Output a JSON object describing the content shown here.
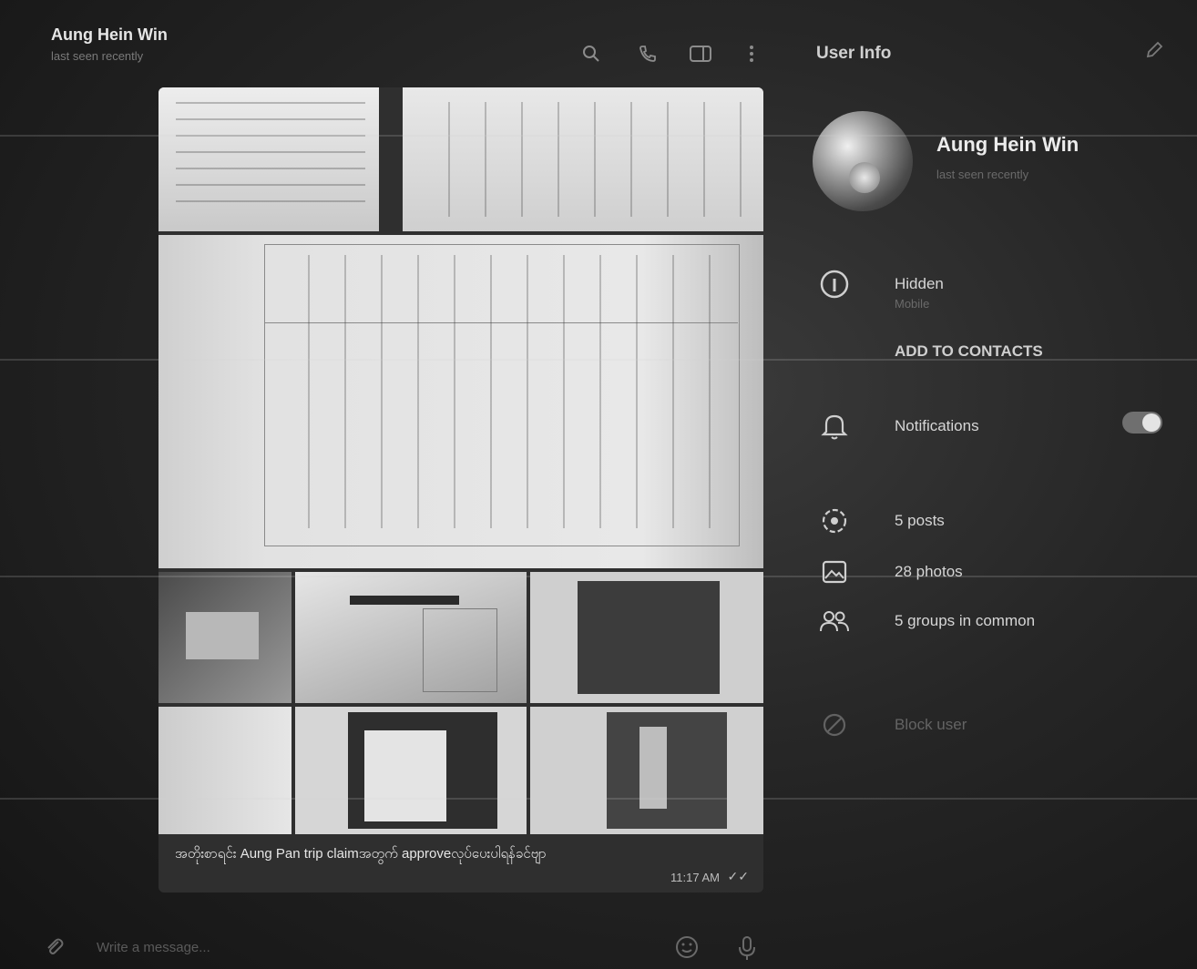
{
  "chat": {
    "name": "Aung Hein Win",
    "status": "last seen recently",
    "header_icons": [
      "search-icon",
      "phone-icon",
      "sidebar-icon",
      "more-icon"
    ],
    "caption": "အတိုးစာရင်း Aung Pan trip claimအတွက် approveလုပ်ပေးပါရန်ခင်ဗျာ",
    "time": "11:17 AM",
    "ticks": "✓✓"
  },
  "composer": {
    "placeholder": "Write a message..."
  },
  "info": {
    "title": "User Info",
    "name": "Aung Hein Win",
    "status": "last seen recently",
    "phone_label": "Hidden",
    "phone_sub": "Mobile",
    "add_contacts": "ADD TO CONTACTS",
    "notifications": "Notifications",
    "notifications_on": true,
    "posts": "5 posts",
    "photos": "28 photos",
    "groups": "5 groups in common",
    "block_label": "Block user"
  }
}
